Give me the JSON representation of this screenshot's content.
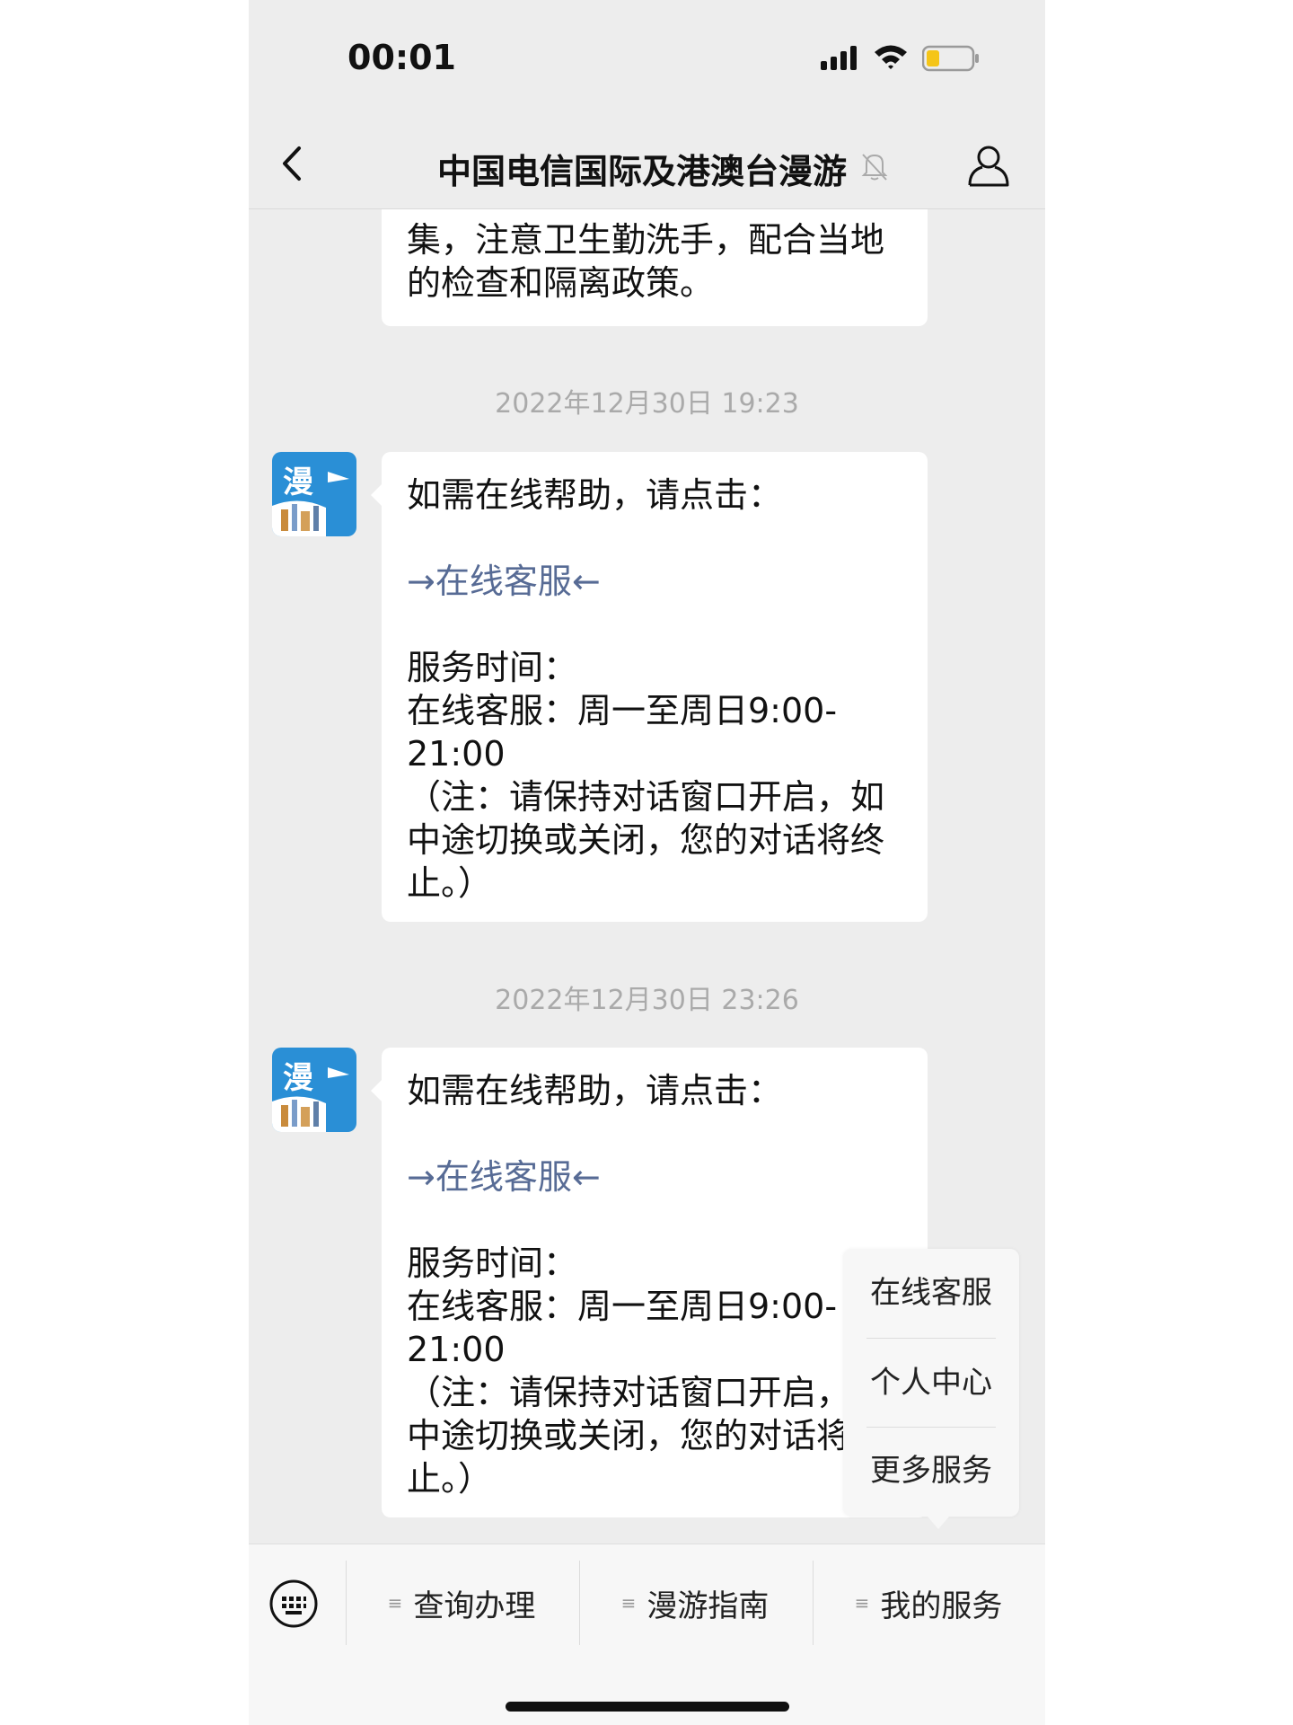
{
  "status_bar": {
    "time": "00:01"
  },
  "nav": {
    "title": "中国电信国际及港澳台漫游"
  },
  "messages": {
    "partial": {
      "lines": [
        "集，注意卫生勤洗手，配合当地",
        "的检查和隔离政策。"
      ]
    },
    "timestamp1": "2022年12月30日 19:23",
    "msg1": {
      "line1": "如需在线帮助，请点击：",
      "link": "→在线客服←",
      "hours_title": "服务时间：",
      "hours_line1": "在线客服：周一至周日9:00-",
      "hours_line2": "21:00",
      "note1": "（注：请保持对话窗口开启，如",
      "note2": "中途切换或关闭，您的对话将终",
      "note3": "止。）"
    },
    "timestamp2": "2022年12月30日 23:26",
    "msg2": {
      "line1": "如需在线帮助，请点击：",
      "link": "→在线客服←",
      "hours_title": "服务时间：",
      "hours_line1": "在线客服：周一至周日9:00-",
      "hours_line2": "21:00",
      "note1": "（注：请保持对话窗口开启，如",
      "note2": "中途切换或关闭，您的对话将终",
      "note3": "止。）"
    },
    "avatar_glyph": "漫"
  },
  "popup_menu": {
    "items": [
      "在线客服",
      "个人中心",
      "更多服务"
    ]
  },
  "bottom_menu": {
    "items": [
      "查询办理",
      "漫游指南",
      "我的服务"
    ]
  },
  "colors": {
    "link": "#576b95",
    "background": "#ededed",
    "avatar": "#2a8fd6",
    "battery": "#f5c518"
  }
}
